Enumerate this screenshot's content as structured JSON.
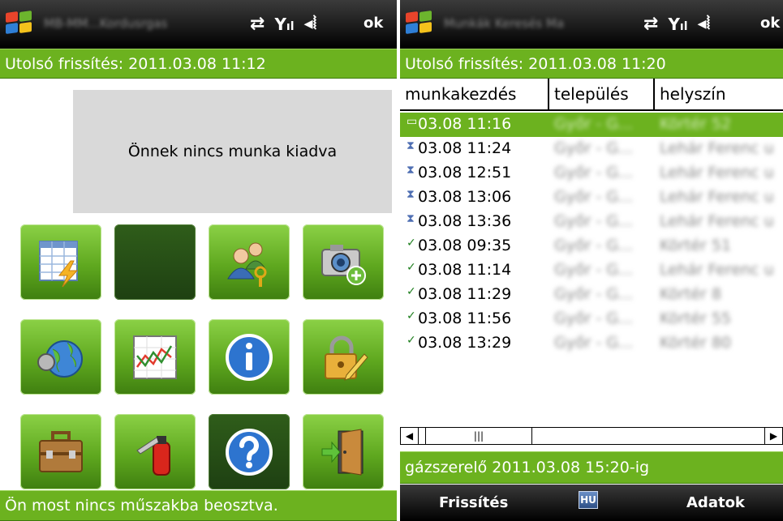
{
  "left": {
    "titlebar": {
      "title": "MB-MM...Kordusrgas",
      "ok_label": "ok"
    },
    "status_top": "Utolsó frissítés: 2011.03.08 11:12",
    "notice": "Önnek nincs munka kiadva",
    "tiles": [
      {
        "icon": "table-lightning-icon"
      },
      {
        "icon": "empty-dark-tile"
      },
      {
        "icon": "users-key-icon"
      },
      {
        "icon": "camera-add-icon"
      },
      {
        "icon": "globe-icon"
      },
      {
        "icon": "chart-icon"
      },
      {
        "icon": "info-icon"
      },
      {
        "icon": "lock-edit-icon"
      },
      {
        "icon": "briefcase-icon"
      },
      {
        "icon": "fire-extinguisher-icon"
      },
      {
        "icon": "help-icon"
      },
      {
        "icon": "exit-door-icon"
      }
    ],
    "status_bottom": "Ön most nincs műszakba beosztva."
  },
  "right": {
    "titlebar": {
      "title": "Munkák Keresés Ma",
      "ok_label": "ok"
    },
    "status_top": "Utolsó frissítés: 2011.03.08 11:20",
    "columns": [
      "munkakezdés",
      "település",
      "helyszín"
    ],
    "rows": [
      {
        "status": "new",
        "time": "03.08 11:16",
        "town": "Győr - G...",
        "place": "Körtér 52"
      },
      {
        "status": "pending",
        "time": "03.08 11:24",
        "town": "Győr - G...",
        "place": "Lehár Ferenc u"
      },
      {
        "status": "pending",
        "time": "03.08 12:51",
        "town": "Győr - G...",
        "place": "Lehár Ferenc u"
      },
      {
        "status": "pending",
        "time": "03.08 13:06",
        "town": "Győr - G...",
        "place": "Lehár Ferenc u"
      },
      {
        "status": "pending",
        "time": "03.08 13:36",
        "town": "Győr - G...",
        "place": "Lehár Ferenc u"
      },
      {
        "status": "done",
        "time": "03.08 09:35",
        "town": "Győr - G...",
        "place": "Körtér 51"
      },
      {
        "status": "done",
        "time": "03.08 11:14",
        "town": "Győr - G...",
        "place": "Lehár Ferenc u"
      },
      {
        "status": "done",
        "time": "03.08 11:29",
        "town": "Győr - G...",
        "place": "Körtér 8"
      },
      {
        "status": "done",
        "time": "03.08 11:56",
        "town": "Győr - G...",
        "place": "Körtér 55"
      },
      {
        "status": "done",
        "time": "03.08 13:29",
        "town": "Győr - G...",
        "place": "Körtér 80"
      }
    ],
    "status_bottom": "gázszerelő 2011.03.08 15:20-ig",
    "menu": {
      "left_softkey": "Frissítés",
      "input_method": "HU",
      "right_softkey": "Adatok"
    }
  },
  "colors": {
    "accent_green": "#6cb21f",
    "bar_black": "#000000",
    "notice_gray": "#d9d9d9"
  }
}
